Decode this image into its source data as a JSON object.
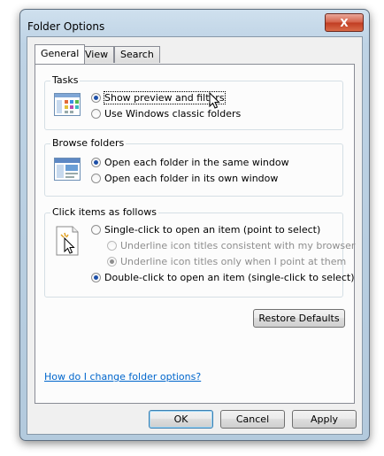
{
  "window": {
    "title": "Folder Options",
    "close_glyph": "X"
  },
  "tabs": [
    {
      "label": "General",
      "active": true
    },
    {
      "label": "View",
      "active": false
    },
    {
      "label": "Search",
      "active": false
    }
  ],
  "tasks": {
    "label": "Tasks",
    "options": [
      {
        "label": "Show preview and filters",
        "checked": true
      },
      {
        "label": "Use Windows classic folders",
        "checked": false
      }
    ],
    "icon": "tasks-pane-icon"
  },
  "browse": {
    "label": "Browse folders",
    "options": [
      {
        "label": "Open each folder in the same window",
        "checked": true
      },
      {
        "label": "Open each folder in its own window",
        "checked": false
      }
    ],
    "icon": "browse-window-icon"
  },
  "click": {
    "label": "Click items as follows",
    "options": [
      {
        "label": "Single-click to open an item (point to select)",
        "checked": false
      },
      {
        "label": "Underline icon titles consistent with my browser",
        "checked": false,
        "disabled": true
      },
      {
        "label": "Underline icon titles only when I point at them",
        "checked": true,
        "disabled": true
      },
      {
        "label": "Double-click to open an item (single-click to select)",
        "checked": true
      }
    ],
    "icon": "click-cursor-icon"
  },
  "restore_defaults": "Restore Defaults",
  "help_link": "How do I change folder options?",
  "buttons": {
    "ok": "OK",
    "cancel": "Cancel",
    "apply": "Apply"
  }
}
